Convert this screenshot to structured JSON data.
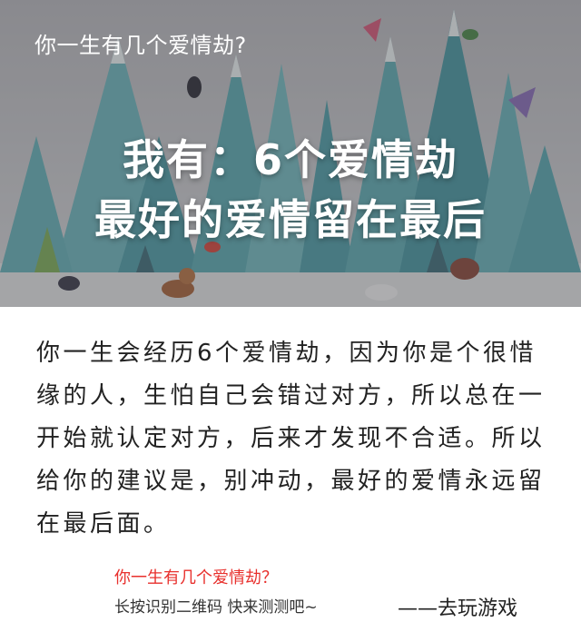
{
  "banner": {
    "question": "你一生有几个爱情劫?",
    "headline_line1": "我有：6个爱情劫",
    "headline_line2": "最好的爱情留在最后"
  },
  "message": {
    "text": "你一生会经历6个爱情劫，因为你是个很惜缘的人，生怕自己会错过对方，所以总在一开始就认定对方，后来才发现不合适。所以给你的建议是，别冲动，最好的爱情永远留在最后面。"
  },
  "footer": {
    "question": "你一生有几个爱情劫？",
    "qr_hint": "长按识别二维码  快来测测吧~",
    "signature": "——去玩游戏"
  },
  "colors": {
    "accent_red": "#e8302d",
    "mountain": "#5aa9b1",
    "mountain_dark": "#3f8e98"
  }
}
